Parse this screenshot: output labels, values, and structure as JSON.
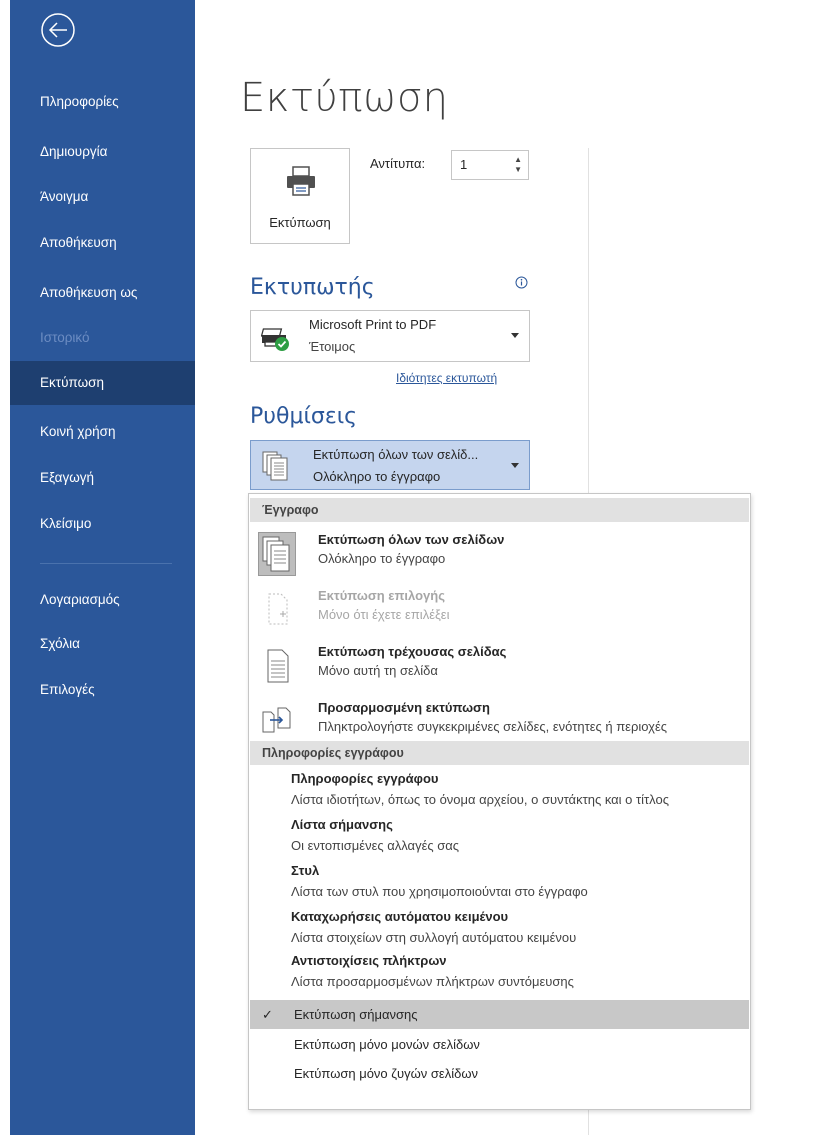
{
  "nav": {
    "items": [
      {
        "label": "Πληροφορίες"
      },
      {
        "label": "Δημιουργία"
      },
      {
        "label": "Άνοιγμα"
      },
      {
        "label": "Αποθήκευση"
      },
      {
        "label": "Αποθήκευση ως"
      },
      {
        "label": "Ιστορικό"
      },
      {
        "label": "Εκτύπωση"
      },
      {
        "label": "Κοινή χρήση"
      },
      {
        "label": "Εξαγωγή"
      },
      {
        "label": "Κλείσιμο"
      },
      {
        "label": "Λογαριασμός"
      },
      {
        "label": "Σχόλια"
      },
      {
        "label": "Επιλογές"
      }
    ],
    "selected": "Εκτύπωση",
    "disabled": "Ιστορικό",
    "back_icon": "back-arrow-circle-icon"
  },
  "page": {
    "title": "Εκτύπωση"
  },
  "print": {
    "button_label": "Εκτύπωση",
    "copies_label": "Αντίτυπα:",
    "copies_value": "1"
  },
  "printer": {
    "section_title": "Εκτυπωτής",
    "name": "Microsoft Print to PDF",
    "status": "Έτοιμος",
    "properties_link": "Ιδιότητες εκτυπωτή"
  },
  "settings": {
    "section_title": "Ρυθμίσεις",
    "pages_main": "Εκτύπωση όλων των σελίδ...",
    "pages_sub": "Ολόκληρο το έγγραφο"
  },
  "menu": {
    "header_document": "Έγγραφο",
    "header_doc_info": "Πληροφορίες εγγράφου",
    "big_items": [
      {
        "title": "Εκτύπωση όλων των σελίδων",
        "desc": "Ολόκληρο το έγγραφο"
      },
      {
        "title": "Εκτύπωση επιλογής",
        "desc": "Μόνο ότι έχετε επιλέξει"
      },
      {
        "title": "Εκτύπωση τρέχουσας σελίδας",
        "desc": "Μόνο αυτή τη σελίδα"
      },
      {
        "title": "Προσαρμοσμένη εκτύπωση",
        "desc": "Πληκτρολογήστε συγκεκριμένες σελίδες, ενότητες  ή περιοχές"
      }
    ],
    "info_items": [
      {
        "title": "Πληροφορίες εγγράφου",
        "desc": "Λίστα ιδιοτήτων, όπως το όνομα αρχείου, ο συντάκτης και ο τίτλος"
      },
      {
        "title": "Λίστα σήμανσης",
        "desc": "Οι εντοπισμένες αλλαγές σας"
      },
      {
        "title": "Στυλ",
        "desc": "Λίστα των στυλ που χρησιμοποιούνται στο έγγραφο"
      },
      {
        "title": "Καταχωρήσεις αυτόματου κειμένου",
        "desc": "Λίστα στοιχείων στη συλλογή αυτόματου κειμένου"
      },
      {
        "title": "Αντιστοιχίσεις πλήκτρων",
        "desc": "Λίστα προσαρμοσμένων πλήκτρων συντόμευσης"
      }
    ],
    "check_items": [
      {
        "label": "Εκτύπωση σήμανσης",
        "check": "✓"
      },
      {
        "label": "Εκτύπωση  μόνο μονών σελίδων"
      },
      {
        "label": "Εκτύπωση μόνο ζυγών σελίδων"
      }
    ]
  },
  "colors": {
    "nav_bg": "#2b579a",
    "nav_selected": "#1e3f70",
    "accent": "#2b579a"
  }
}
